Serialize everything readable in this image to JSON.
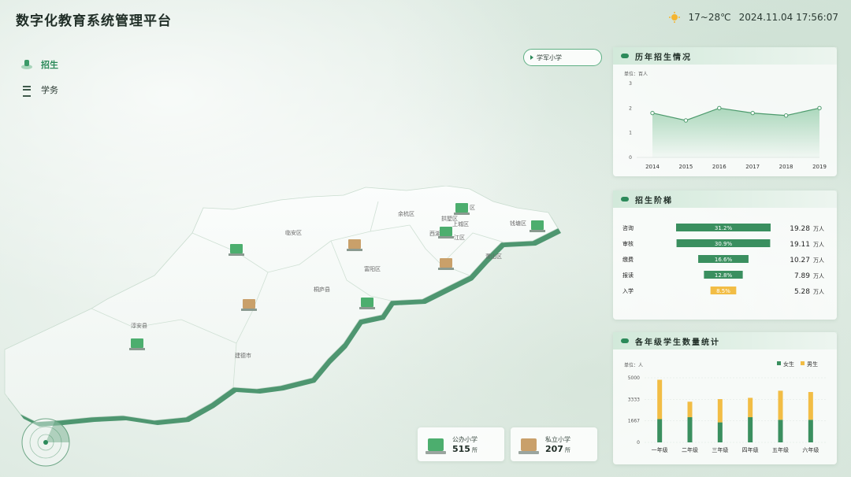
{
  "header": {
    "title": "数字化教育系统管理平台",
    "temperature": "17~28℃",
    "datetime": "2024.11.04 17:56:07"
  },
  "nav": {
    "items": [
      {
        "label": "招生",
        "active": true
      },
      {
        "label": "学务",
        "active": false
      }
    ]
  },
  "school_select": {
    "value": "学军小学"
  },
  "map": {
    "districts": [
      "余杭区",
      "拱墅区",
      "上城区",
      "西湖区",
      "滨江区",
      "临安区",
      "钱塘区",
      "萧山区",
      "富阳区",
      "桐庐县",
      "淳安县",
      "建德市"
    ],
    "district_label_partial": [
      "区",
      "西",
      "江区"
    ]
  },
  "stats": {
    "public_label": "公办小学",
    "public_value": "515",
    "private_label": "私立小学",
    "private_value": "207",
    "unit": "所"
  },
  "panels": {
    "history_title": "历年招生情况",
    "stage_title": "招生阶梯",
    "grade_title": "各年级学生数量统计"
  },
  "colors": {
    "primary_green": "#2c8a5a",
    "bar_green": "#3a8f5f",
    "bar_yellow": "#f2bd45",
    "area_green": "#8cc9a3"
  },
  "chart_data": [
    {
      "type": "area",
      "title": "历年招生情况",
      "unit_label": "单位：百人",
      "x": [
        "2014",
        "2015",
        "2016",
        "2017",
        "2018",
        "2019"
      ],
      "values": [
        1.8,
        1.5,
        2.0,
        1.8,
        1.7,
        2.0
      ],
      "ylim": [
        0,
        3
      ],
      "yticks": [
        "0",
        "1",
        "2",
        "3"
      ],
      "grid": false
    },
    {
      "type": "bar",
      "orientation": "horizontal",
      "title": "招生阶梯",
      "categories": [
        "咨询",
        "审核",
        "缴费",
        "报读",
        "入学"
      ],
      "percents": [
        31.2,
        30.9,
        16.6,
        12.8,
        8.5
      ],
      "percent_labels": [
        "31.2%",
        "30.9%",
        "16.6%",
        "12.8%",
        "8.5%"
      ],
      "values": [
        "19.28",
        "19.11",
        "10.27",
        "7.89",
        "5.28"
      ],
      "value_unit": "万人",
      "colors": [
        "#3a8f5f",
        "#3a8f5f",
        "#3a8f5f",
        "#3a8f5f",
        "#f2bd45"
      ]
    },
    {
      "type": "bar",
      "stacked": true,
      "title": "各年级学生数量统计",
      "unit_label": "单位：人",
      "categories": [
        "一年级",
        "二年级",
        "三年级",
        "四年级",
        "五年级",
        "六年级"
      ],
      "series": [
        {
          "name": "女生",
          "values": [
            1800,
            1950,
            1550,
            1950,
            1750,
            1750
          ],
          "color": "#3a8f5f"
        },
        {
          "name": "男生",
          "values": [
            3050,
            1200,
            1800,
            1500,
            2250,
            2150
          ],
          "color": "#f2bd45"
        }
      ],
      "ylim": [
        0,
        5000
      ],
      "yticks": [
        "0",
        "1667",
        "3333",
        "5000"
      ],
      "legend": "top-right"
    }
  ]
}
